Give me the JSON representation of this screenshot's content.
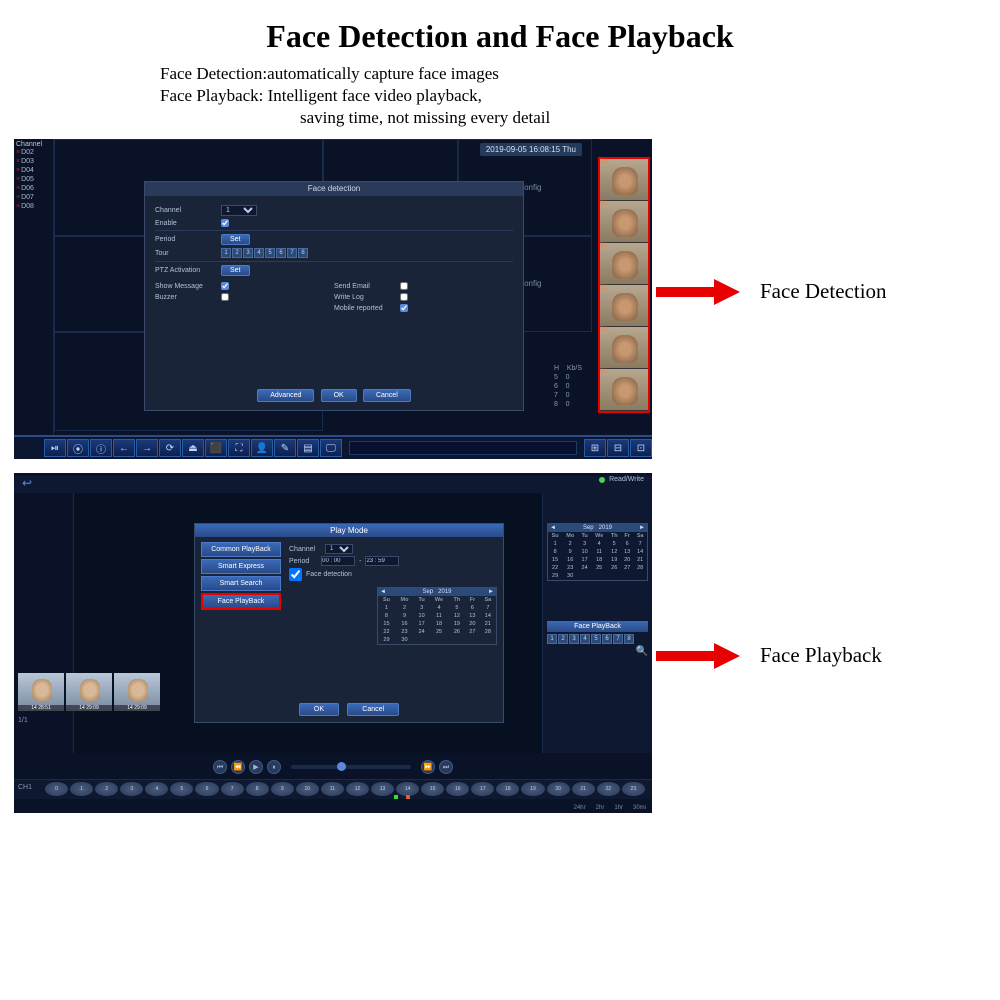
{
  "page": {
    "title": "Face Detection and Face Playback",
    "line1": "Face Detection:automatically capture face images",
    "line2": "Face Playback: Intelligent face video playback,",
    "line3": "saving time, not missing every detail"
  },
  "labels": {
    "face_detection": "Face Detection",
    "face_playback": "Face Playback"
  },
  "nvr1": {
    "sidebar_header": "Channel",
    "channels": [
      "D02",
      "D03",
      "D04",
      "D05",
      "D06",
      "D07",
      "D08"
    ],
    "timestamp": "2019-09-05 16:08:15 Thu",
    "noconfig": "NoConfig",
    "dialog": {
      "title": "Face detection",
      "channel_label": "Channel",
      "channel_value": "1",
      "enable_label": "Enable",
      "period_label": "Period",
      "set_btn": "Set",
      "tour_label": "Tour",
      "tour_values": [
        "1",
        "2",
        "3",
        "4",
        "5",
        "6",
        "7",
        "8"
      ],
      "ptz_label": "PTZ Activation",
      "show_message": "Show Message",
      "buzzer": "Buzzer",
      "send_email": "Send Email",
      "write_log": "Write Log",
      "mobile_reported": "Mobile reported",
      "btn_advanced": "Advanced",
      "btn_ok": "OK",
      "btn_cancel": "Cancel"
    },
    "stats": {
      "h": "H",
      "kbs": "Kb/S",
      "rows": [
        [
          "5",
          "0"
        ],
        [
          "6",
          "0"
        ],
        [
          "7",
          "0"
        ],
        [
          "8",
          "0"
        ]
      ]
    },
    "face_nums": [
      "01",
      "01",
      "01",
      "01",
      "01",
      "01"
    ],
    "toolbar_icons": [
      "⏯",
      "⦿",
      "ⓘ",
      "←",
      "→",
      "⟳",
      "⏏",
      "⬛",
      "⛶",
      "👤",
      "✎",
      "▤",
      "🖵",
      "⊞",
      "⊟",
      "⊡"
    ]
  },
  "nvr2": {
    "read_write": "Read/Write",
    "dialog": {
      "title": "Play Mode",
      "tabs": [
        "Common PlayBack",
        "Smart Express",
        "Smart Search",
        "Face PlayBack"
      ],
      "active_tab": 3,
      "channel_label": "Channel",
      "channel_value": "1",
      "period_label": "Period",
      "period_from": "00 : 00",
      "period_to": "23 : 59",
      "face_detection_label": "Face detection",
      "btn_ok": "OK",
      "btn_cancel": "Cancel"
    },
    "calendar": {
      "month": "Sep",
      "year": "2019",
      "days": [
        "Su",
        "Mo",
        "Tu",
        "We",
        "Th",
        "Fr",
        "Sa"
      ],
      "weeks": [
        [
          "1",
          "2",
          "3",
          "4",
          "5",
          "6",
          "7"
        ],
        [
          "8",
          "9",
          "10",
          "11",
          "12",
          "13",
          "14"
        ],
        [
          "15",
          "16",
          "17",
          "18",
          "19",
          "20",
          "21"
        ],
        [
          "22",
          "23",
          "24",
          "25",
          "26",
          "27",
          "28"
        ],
        [
          "29",
          "30",
          "",
          "",
          "",
          "",
          ""
        ]
      ]
    },
    "right": {
      "face_playback": "Face PlayBack",
      "boxes": [
        "1",
        "2",
        "3",
        "4",
        "5",
        "6",
        "7",
        "8"
      ]
    },
    "thumbs": [
      "14 28:51",
      "14 29:09",
      "14 29:09"
    ],
    "page_info": "1/1",
    "ch_label": "CH1",
    "hours": [
      "0",
      "1",
      "2",
      "3",
      "4",
      "5",
      "6",
      "7",
      "8",
      "9",
      "10",
      "11",
      "12",
      "13",
      "14",
      "15",
      "16",
      "17",
      "18",
      "19",
      "20",
      "21",
      "22",
      "23"
    ],
    "zoom": [
      "24hr",
      "2hr",
      "1hr",
      "30mi"
    ],
    "playback_icons": [
      "⏮",
      "⏪",
      "▶",
      "⏸",
      "⏩",
      "⏭"
    ]
  }
}
